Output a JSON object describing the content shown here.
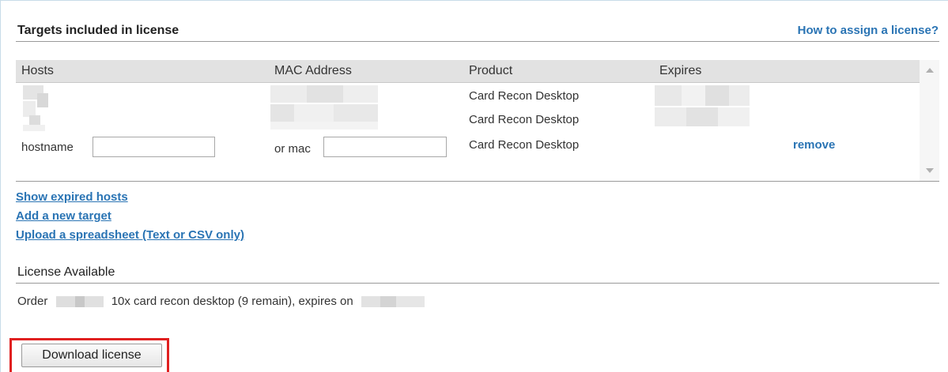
{
  "section": {
    "title": "Targets included in license",
    "help_link": "How to assign a license?"
  },
  "table": {
    "columns": [
      "Hosts",
      "MAC Address",
      "Product",
      "Expires"
    ],
    "rows": [
      {
        "product": "Card Recon Desktop"
      },
      {
        "product": "Card Recon Desktop"
      },
      {
        "product": "Card Recon Desktop",
        "action": "remove"
      }
    ],
    "new_row": {
      "hostname_label": "hostname",
      "hostname_value": "",
      "mac_label": "or mac",
      "mac_value": ""
    }
  },
  "links": {
    "show_expired": "Show expired hosts",
    "add_target": "Add a new target",
    "upload": "Upload a spreadsheet (Text or CSV only)"
  },
  "license_available": {
    "title": "License Available",
    "order_prefix": "Order",
    "order_text": "10x card recon desktop (9 remain), expires on"
  },
  "download_button": "Download license",
  "colors": {
    "link": "#2a74b4",
    "highlight": "#e02020"
  }
}
